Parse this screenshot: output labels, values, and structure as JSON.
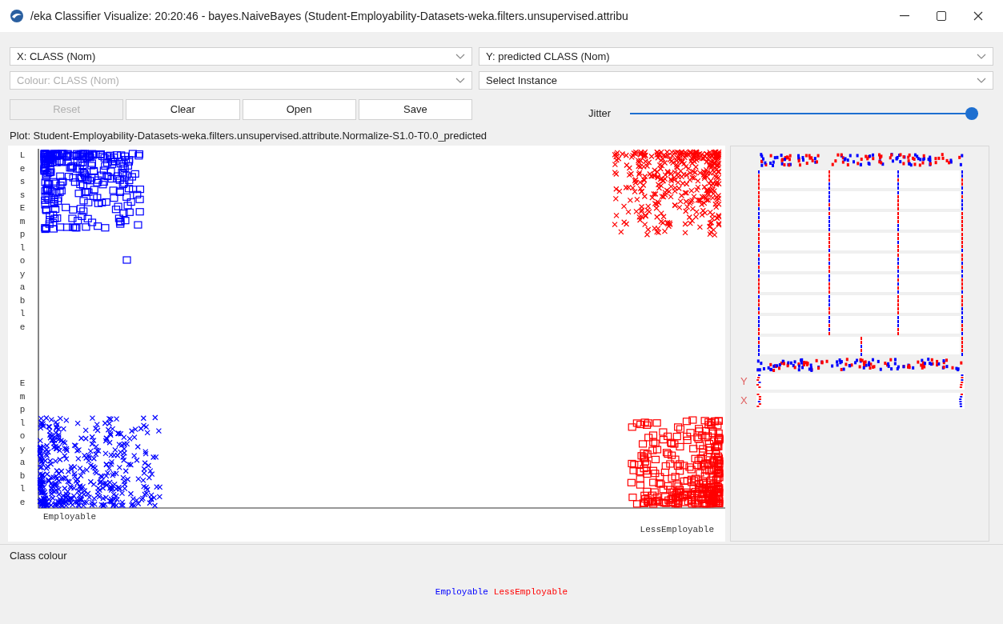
{
  "window": {
    "title": "/eka Classifier Visualize: 20:20:46 - bayes.NaiveBayes (Student-Employability-Datasets-weka.filters.unsupervised.attribu"
  },
  "selects": [
    {
      "value": "X: CLASS (Nom)",
      "disabled": false
    },
    {
      "value": "Y: predicted CLASS (Nom)",
      "disabled": false
    },
    {
      "value": "Colour: CLASS (Nom)",
      "disabled": true
    },
    {
      "value": "Select Instance",
      "disabled": false
    }
  ],
  "buttons": [
    {
      "label": "Reset",
      "disabled": true
    },
    {
      "label": "Clear",
      "disabled": false
    },
    {
      "label": "Open",
      "disabled": false
    },
    {
      "label": "Save",
      "disabled": false
    }
  ],
  "jitter": {
    "label": "Jitter",
    "level": 1
  },
  "plot": {
    "title": "Plot: Student-Employability-Datasets-weka.filters.unsupervised.attribute.Normalize-S1.0-T0.0_predicted",
    "y_labels": [
      "LessEmployable",
      "Employable"
    ],
    "x_labels": [
      "Employable",
      "LessEmployable"
    ]
  },
  "attribute_panel": {
    "axis_labels": [
      "Y",
      "X"
    ]
  },
  "class_colour": {
    "title": "Class colour",
    "classes": [
      {
        "name": "Employable",
        "color": "#0000ff"
      },
      {
        "name": "LessEmployable",
        "color": "#ff0000"
      }
    ]
  }
}
